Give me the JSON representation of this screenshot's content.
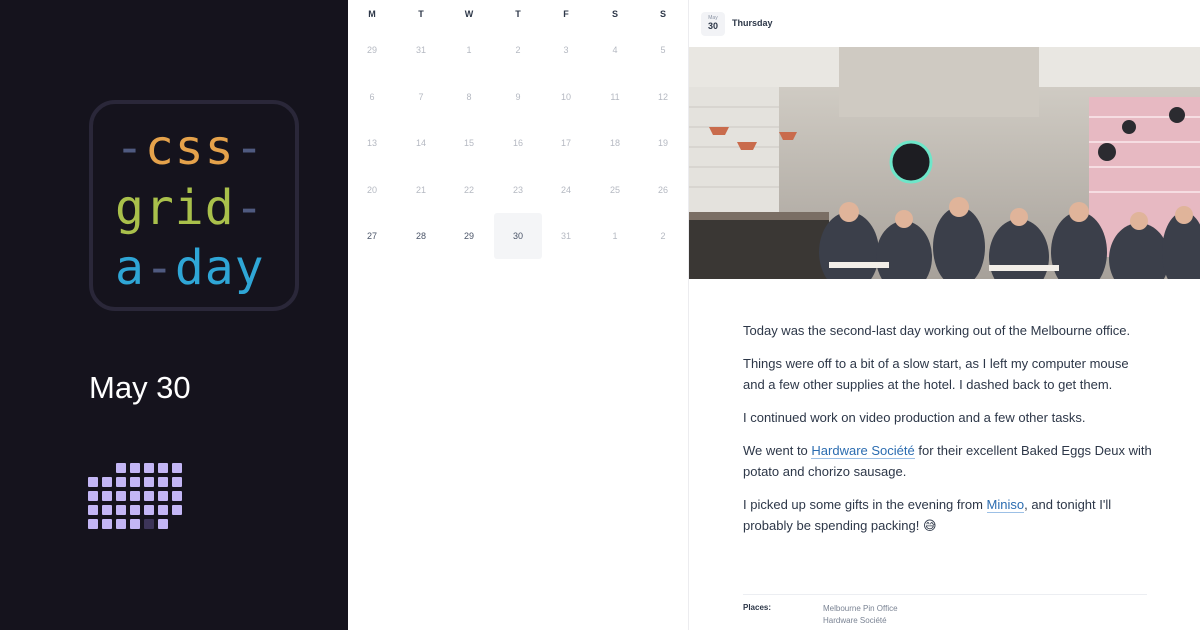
{
  "brand": {
    "logo_line1_word": "css",
    "logo_line2_word": "grid",
    "logo_line3_word": "a",
    "logo_line3_word2": "day",
    "dash": "-",
    "colors": {
      "orange": "#e5a24b",
      "green": "#a9c04b",
      "blue": "#2fa6d6",
      "dash": "#4f5a80"
    }
  },
  "sidebar": {
    "date": "May 30"
  },
  "calendar": {
    "weekdays": [
      "M",
      "T",
      "W",
      "T",
      "F",
      "S",
      "S"
    ],
    "weeks": [
      [
        "29",
        "31",
        "1",
        "2",
        "3",
        "4",
        "5"
      ],
      [
        "6",
        "7",
        "8",
        "9",
        "10",
        "11",
        "12"
      ],
      [
        "13",
        "14",
        "15",
        "16",
        "17",
        "18",
        "19"
      ],
      [
        "20",
        "21",
        "22",
        "23",
        "24",
        "25",
        "26"
      ],
      [
        "27",
        "28",
        "29",
        "30",
        "31",
        "1",
        "2"
      ]
    ],
    "selected_day": "30"
  },
  "entry": {
    "badge_month": "May",
    "badge_day": "30",
    "weekday": "Thursday",
    "photo_icon": "restaurant-photo",
    "p1": "Today was the second-last day working out of the Melbourne office.",
    "p2": "Things were off to a bit of a slow start, as I left my computer mouse and a few other supplies at the hotel. I dashed back to get them.",
    "p3": "I continued work on video production and a few other tasks.",
    "p4_before": "We went to ",
    "p4_link": "Hardware Société",
    "p4_after": " for their excellent Baked Eggs Deux with potato and chorizo sausage.",
    "p5_before": "I picked up some gifts in the evening from ",
    "p5_link": "Miniso",
    "p5_after": ", and tonight I'll probably be spending packing! 😅",
    "places_label": "Places:",
    "places": [
      "Melbourne Pin Office",
      "Hardware Société"
    ]
  }
}
